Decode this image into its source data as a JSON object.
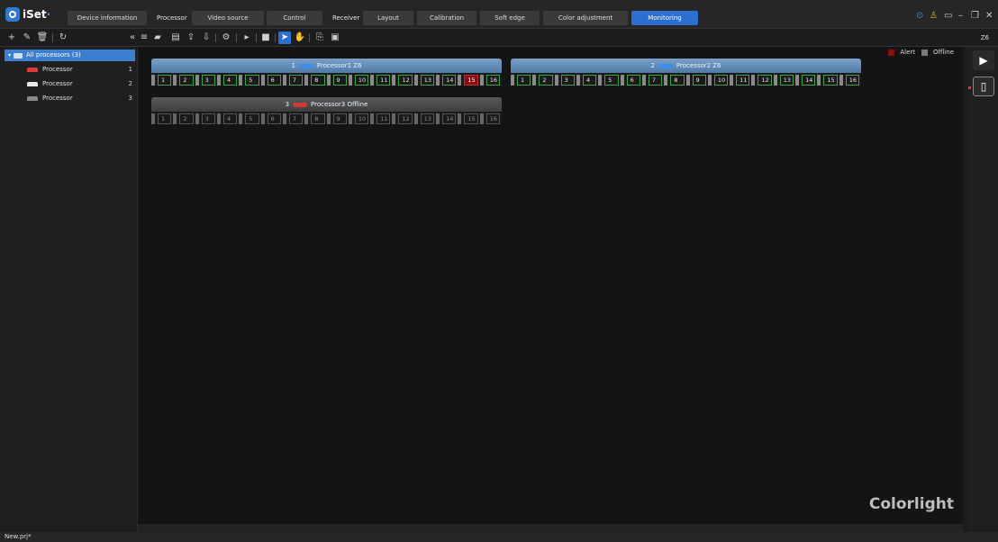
{
  "app": {
    "logo_text": "iSet",
    "nav": {
      "device_info": "Device information",
      "processor_label": "Processor",
      "video_source": "Video source",
      "control": "Control",
      "receiver_label": "Receiver",
      "layout": "Layout",
      "calibration": "Calibration",
      "soft_edge": "Soft edge",
      "color_adjustment": "Color adjustment",
      "monitoring": "Monitoring",
      "active_tab": "Monitoring"
    },
    "toolbar": {
      "right_label": "Z6"
    },
    "accent_color": "#2b6fd0"
  },
  "sidebar": {
    "root_label": "All processors (3)",
    "items": [
      {
        "label": "Processor",
        "index": "1",
        "color": "#e23a3a"
      },
      {
        "label": "Processor",
        "index": "2",
        "color": "#e8e8e8"
      },
      {
        "label": "Processor",
        "index": "3",
        "color": "#8a8a8a"
      }
    ]
  },
  "canvas": {
    "legend": {
      "alert": "Alert",
      "offline": "Offline",
      "alert_color": "#8b0e0e",
      "offline_color": "#7a7a7a"
    },
    "processors": [
      {
        "number": "1",
        "title": "Processor1 Z6",
        "status": "online",
        "alert_port": "15"
      },
      {
        "number": "2",
        "title": "Processor2 Z6",
        "status": "online",
        "alert_port": ""
      },
      {
        "number": "3",
        "title": "Processor3 Offline",
        "status": "offline",
        "alert_port": ""
      }
    ],
    "ports": [
      "1",
      "2",
      "3",
      "4",
      "5",
      "6",
      "7",
      "8",
      "9",
      "10",
      "11",
      "12",
      "13",
      "14",
      "15",
      "16"
    ],
    "brand": "Colorlight"
  },
  "statusbar": {
    "file": "New.prj*"
  }
}
